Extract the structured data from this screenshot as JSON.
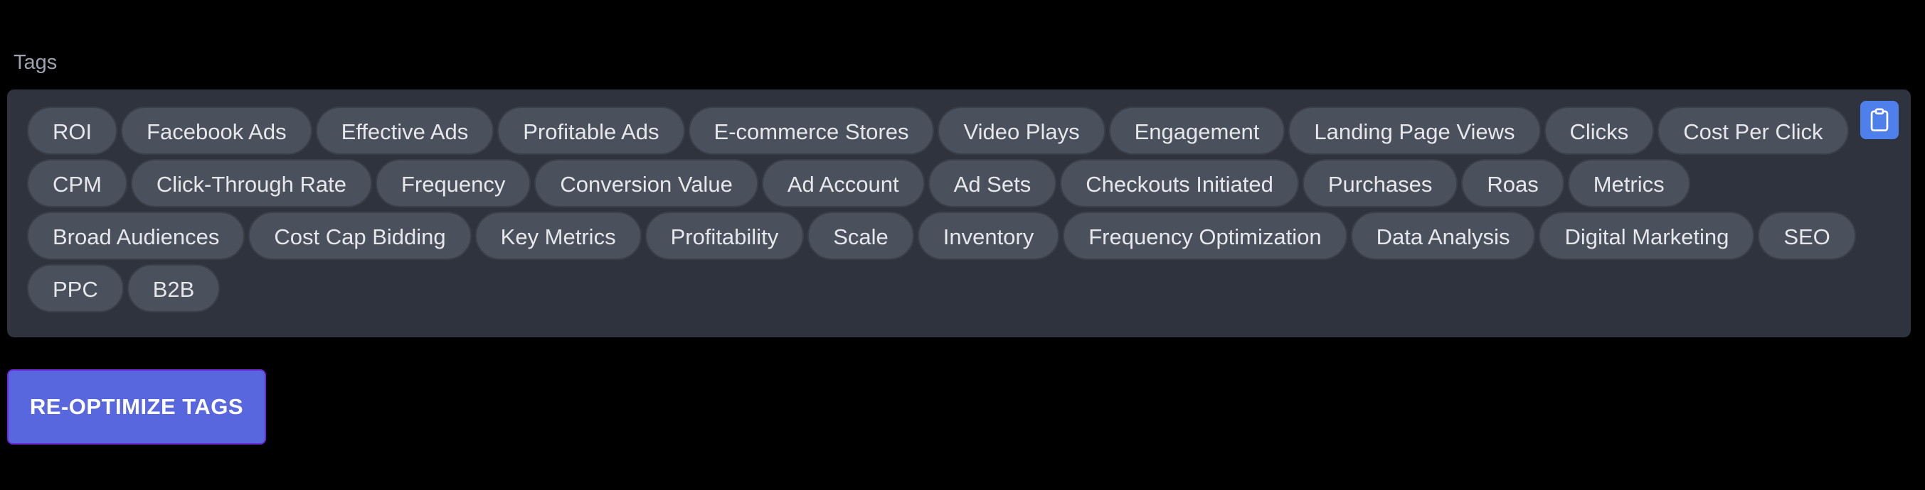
{
  "section": {
    "label": "Tags"
  },
  "tags": [
    "ROI",
    "Facebook Ads",
    "Effective Ads",
    "Profitable Ads",
    "E-commerce Stores",
    "Video Plays",
    "Engagement",
    "Landing Page Views",
    "Clicks",
    "Cost Per Click",
    "CPM",
    "Click-Through Rate",
    "Frequency",
    "Conversion Value",
    "Ad Account",
    "Ad Sets",
    "Checkouts Initiated",
    "Purchases",
    "Roas",
    "Metrics",
    "Broad Audiences",
    "Cost Cap Bidding",
    "Key Metrics",
    "Profitability",
    "Scale",
    "Inventory",
    "Frequency Optimization",
    "Data Analysis",
    "Digital Marketing",
    "SEO",
    "PPC",
    "B2B"
  ],
  "copy_button": {
    "icon": "clipboard-icon"
  },
  "actions": {
    "reoptimize_label": "RE-OPTIMIZE TAGS"
  },
  "colors": {
    "background": "#000000",
    "panel": "#2f333d",
    "tag_bg": "#4a505c",
    "tag_text": "#e5e7eb",
    "copy_button": "#4f7fea",
    "primary_button": "#5867dd"
  }
}
